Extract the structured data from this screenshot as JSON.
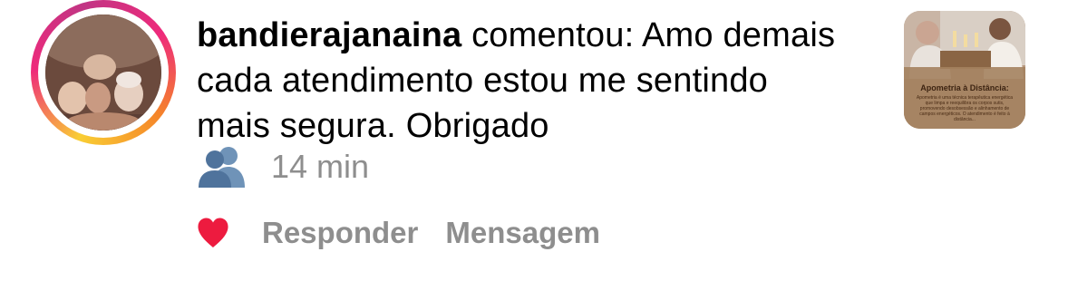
{
  "comment": {
    "username": "bandierajanaina",
    "text": " comentou: Amo demais cada atendimento estou me sentindo mais segura. Obrigado"
  },
  "meta": {
    "time": "14 min",
    "icon": "people-group-icon"
  },
  "actions": {
    "like_icon": "heart-icon",
    "reply_label": "Responder",
    "message_label": "Mensagem"
  },
  "thumbnail": {
    "title": "Apometria à Distância:",
    "body": "Apometria é uma técnica terapêutica energética que limpa e reequilibra os corpos sutis, promovendo desobsessão e alinhamento de campos energéticos. O atendimento é feito à distância..."
  },
  "colors": {
    "heart": "#ed1b3f",
    "secondary_text": "#8e8e8e",
    "group_icon": "#5b7fa6"
  }
}
